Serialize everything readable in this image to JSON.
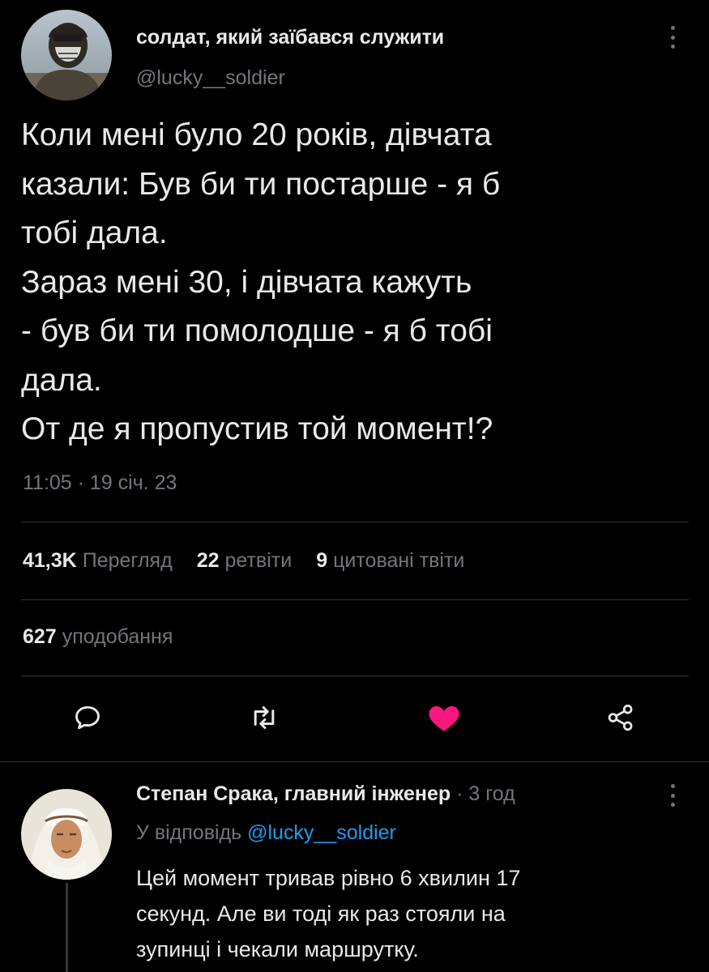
{
  "tweet": {
    "author_name": "солдат, який заїбався служити",
    "author_handle": "@lucky__soldier",
    "text_lines": [
      "Коли мені було 20 років, дівчата",
      "казали: Був би ти постарше - я б",
      "тобі дала.",
      "Зараз мені 30, і дівчата кажуть",
      "- був би ти помолодше - я б тобі",
      "дала.",
      "От де я пропустив той момент!?"
    ],
    "timestamp": "11:05 · 19 січ. 23",
    "stats": {
      "views_count": "41,3K",
      "views_label": "Перегляд",
      "retweets_count": "22",
      "retweets_label": "ретвіти",
      "quotes_count": "9",
      "quotes_label": "цитовані твіти",
      "likes_count": "627",
      "likes_label": "уподобання"
    },
    "like_color": "#f91880"
  },
  "actions": {
    "reply_icon": "reply-icon",
    "retweet_icon": "retweet-icon",
    "like_icon": "heart-filled-icon",
    "share_icon": "share-icon"
  },
  "reply": {
    "author_name": "Степан Срака, главний інженер",
    "meta": "· 3 год",
    "reply_to_prefix": "У відповідь",
    "reply_to_handle": "@lucky__soldier",
    "text_lines": [
      "Цей момент тривав рівно 6 хвилин 17",
      "секунд. Але ви тоді як раз стояли на",
      "зупинці і чекали маршрутку."
    ]
  },
  "colors": {
    "background": "#000000",
    "text": "#e7e9ea",
    "secondary": "#71767b",
    "accent": "#1d9bf0"
  }
}
